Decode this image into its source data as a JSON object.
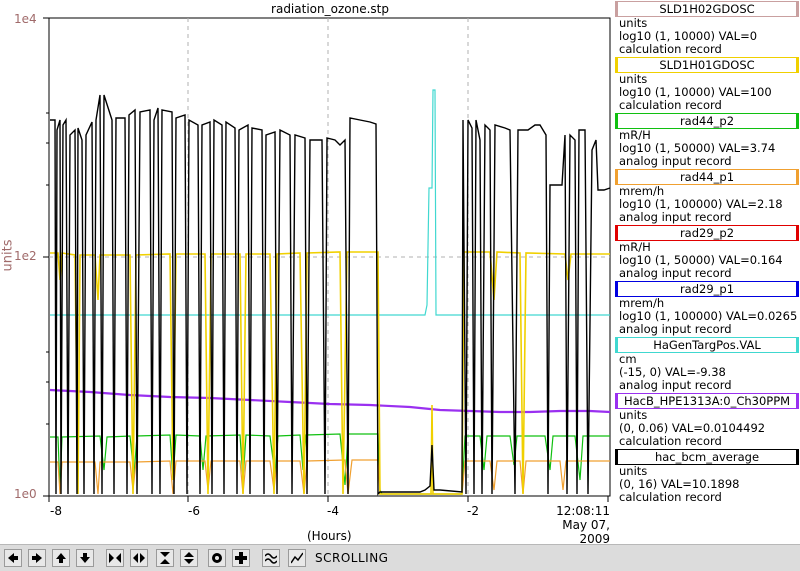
{
  "plot": {
    "title": "radiation_ozone.stp",
    "y_axis_label": "units",
    "y_ticks": [
      "1e4",
      "1e2",
      "1e0"
    ],
    "x_ticks": [
      "-8",
      "-6",
      "-4",
      "-2"
    ],
    "x_axis_label": "(Hours)",
    "end_time": "12:08:11",
    "end_date": "May 07, 2009"
  },
  "legend": [
    {
      "name": "SLD1H02GDOSC",
      "color": "#c9a0a0",
      "unit": "units",
      "range_value": "log10 (1, 10000)  VAL=0",
      "record": "calculation record"
    },
    {
      "name": "SLD1H01GDOSC",
      "color": "#f0d000",
      "unit": "units",
      "range_value": "log10 (1, 10000) VAL=100",
      "record": "calculation record"
    },
    {
      "name": "rad44_p2",
      "color": "#10c010",
      "unit": "mR/H",
      "range_value": "log10 (1, 50000) VAL=3.74",
      "record": "analog input record"
    },
    {
      "name": "rad44_p1",
      "color": "#f0a030",
      "unit": "mrem/h",
      "range_value": "log10 (1, 100000) VAL=2.18",
      "record": "analog input record"
    },
    {
      "name": "rad29_p2",
      "color": "#e00000",
      "unit": "mR/H",
      "range_value": "log10 (1, 50000) VAL=0.164",
      "record": "analog input record"
    },
    {
      "name": "rad29_p1",
      "color": "#0000e0",
      "unit": "mrem/h",
      "range_value": "log10 (1, 100000) VAL=0.0265",
      "record": "analog input record"
    },
    {
      "name": "HaGenTargPos.VAL",
      "color": "#40d8d0",
      "unit": "cm",
      "range_value": "(-15, 0) VAL=-9.38",
      "record": "analog input record"
    },
    {
      "name": "HacB_HPE1313A:0_Ch30PPM",
      "color": "#9a30f0",
      "unit": "units",
      "range_value": "(0, 0.06) VAL=0.0104492",
      "record": "calculation record"
    },
    {
      "name": "hac_bcm_average",
      "color": "#000000",
      "unit": "units",
      "range_value": "(0, 16) VAL=10.1898",
      "record": "calculation record"
    }
  ],
  "toolbar": {
    "status": "SCROLLING",
    "buttons": [
      "pan-left",
      "pan-right",
      "pan-up",
      "pan-down",
      "zoom-in-x",
      "zoom-out-x",
      "zoom-in-y",
      "zoom-out-y",
      "stop",
      "add",
      "autoscale",
      "config"
    ]
  }
}
